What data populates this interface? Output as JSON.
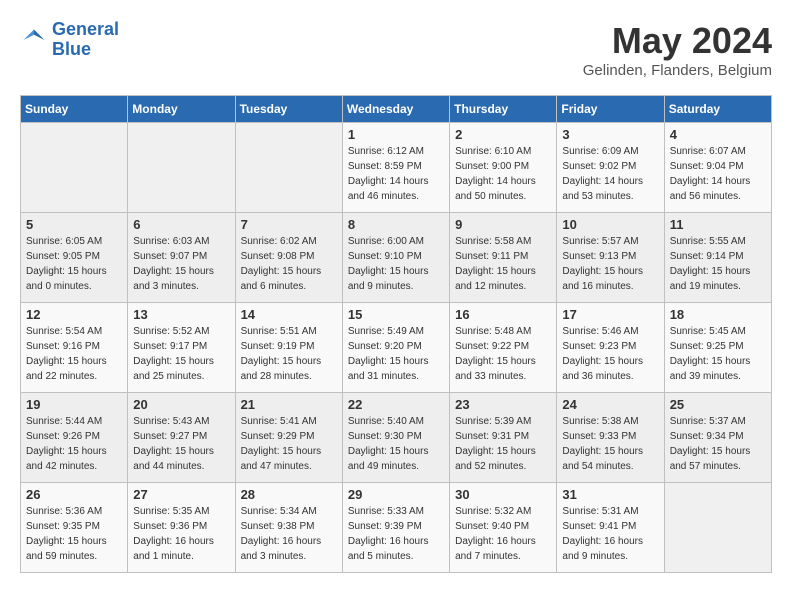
{
  "header": {
    "logo_line1": "General",
    "logo_line2": "Blue",
    "month": "May 2024",
    "location": "Gelinden, Flanders, Belgium"
  },
  "days_of_week": [
    "Sunday",
    "Monday",
    "Tuesday",
    "Wednesday",
    "Thursday",
    "Friday",
    "Saturday"
  ],
  "weeks": [
    [
      {
        "day": "",
        "info": ""
      },
      {
        "day": "",
        "info": ""
      },
      {
        "day": "",
        "info": ""
      },
      {
        "day": "1",
        "info": "Sunrise: 6:12 AM\nSunset: 8:59 PM\nDaylight: 14 hours\nand 46 minutes."
      },
      {
        "day": "2",
        "info": "Sunrise: 6:10 AM\nSunset: 9:00 PM\nDaylight: 14 hours\nand 50 minutes."
      },
      {
        "day": "3",
        "info": "Sunrise: 6:09 AM\nSunset: 9:02 PM\nDaylight: 14 hours\nand 53 minutes."
      },
      {
        "day": "4",
        "info": "Sunrise: 6:07 AM\nSunset: 9:04 PM\nDaylight: 14 hours\nand 56 minutes."
      }
    ],
    [
      {
        "day": "5",
        "info": "Sunrise: 6:05 AM\nSunset: 9:05 PM\nDaylight: 15 hours\nand 0 minutes."
      },
      {
        "day": "6",
        "info": "Sunrise: 6:03 AM\nSunset: 9:07 PM\nDaylight: 15 hours\nand 3 minutes."
      },
      {
        "day": "7",
        "info": "Sunrise: 6:02 AM\nSunset: 9:08 PM\nDaylight: 15 hours\nand 6 minutes."
      },
      {
        "day": "8",
        "info": "Sunrise: 6:00 AM\nSunset: 9:10 PM\nDaylight: 15 hours\nand 9 minutes."
      },
      {
        "day": "9",
        "info": "Sunrise: 5:58 AM\nSunset: 9:11 PM\nDaylight: 15 hours\nand 12 minutes."
      },
      {
        "day": "10",
        "info": "Sunrise: 5:57 AM\nSunset: 9:13 PM\nDaylight: 15 hours\nand 16 minutes."
      },
      {
        "day": "11",
        "info": "Sunrise: 5:55 AM\nSunset: 9:14 PM\nDaylight: 15 hours\nand 19 minutes."
      }
    ],
    [
      {
        "day": "12",
        "info": "Sunrise: 5:54 AM\nSunset: 9:16 PM\nDaylight: 15 hours\nand 22 minutes."
      },
      {
        "day": "13",
        "info": "Sunrise: 5:52 AM\nSunset: 9:17 PM\nDaylight: 15 hours\nand 25 minutes."
      },
      {
        "day": "14",
        "info": "Sunrise: 5:51 AM\nSunset: 9:19 PM\nDaylight: 15 hours\nand 28 minutes."
      },
      {
        "day": "15",
        "info": "Sunrise: 5:49 AM\nSunset: 9:20 PM\nDaylight: 15 hours\nand 31 minutes."
      },
      {
        "day": "16",
        "info": "Sunrise: 5:48 AM\nSunset: 9:22 PM\nDaylight: 15 hours\nand 33 minutes."
      },
      {
        "day": "17",
        "info": "Sunrise: 5:46 AM\nSunset: 9:23 PM\nDaylight: 15 hours\nand 36 minutes."
      },
      {
        "day": "18",
        "info": "Sunrise: 5:45 AM\nSunset: 9:25 PM\nDaylight: 15 hours\nand 39 minutes."
      }
    ],
    [
      {
        "day": "19",
        "info": "Sunrise: 5:44 AM\nSunset: 9:26 PM\nDaylight: 15 hours\nand 42 minutes."
      },
      {
        "day": "20",
        "info": "Sunrise: 5:43 AM\nSunset: 9:27 PM\nDaylight: 15 hours\nand 44 minutes."
      },
      {
        "day": "21",
        "info": "Sunrise: 5:41 AM\nSunset: 9:29 PM\nDaylight: 15 hours\nand 47 minutes."
      },
      {
        "day": "22",
        "info": "Sunrise: 5:40 AM\nSunset: 9:30 PM\nDaylight: 15 hours\nand 49 minutes."
      },
      {
        "day": "23",
        "info": "Sunrise: 5:39 AM\nSunset: 9:31 PM\nDaylight: 15 hours\nand 52 minutes."
      },
      {
        "day": "24",
        "info": "Sunrise: 5:38 AM\nSunset: 9:33 PM\nDaylight: 15 hours\nand 54 minutes."
      },
      {
        "day": "25",
        "info": "Sunrise: 5:37 AM\nSunset: 9:34 PM\nDaylight: 15 hours\nand 57 minutes."
      }
    ],
    [
      {
        "day": "26",
        "info": "Sunrise: 5:36 AM\nSunset: 9:35 PM\nDaylight: 15 hours\nand 59 minutes."
      },
      {
        "day": "27",
        "info": "Sunrise: 5:35 AM\nSunset: 9:36 PM\nDaylight: 16 hours\nand 1 minute."
      },
      {
        "day": "28",
        "info": "Sunrise: 5:34 AM\nSunset: 9:38 PM\nDaylight: 16 hours\nand 3 minutes."
      },
      {
        "day": "29",
        "info": "Sunrise: 5:33 AM\nSunset: 9:39 PM\nDaylight: 16 hours\nand 5 minutes."
      },
      {
        "day": "30",
        "info": "Sunrise: 5:32 AM\nSunset: 9:40 PM\nDaylight: 16 hours\nand 7 minutes."
      },
      {
        "day": "31",
        "info": "Sunrise: 5:31 AM\nSunset: 9:41 PM\nDaylight: 16 hours\nand 9 minutes."
      },
      {
        "day": "",
        "info": ""
      }
    ]
  ]
}
